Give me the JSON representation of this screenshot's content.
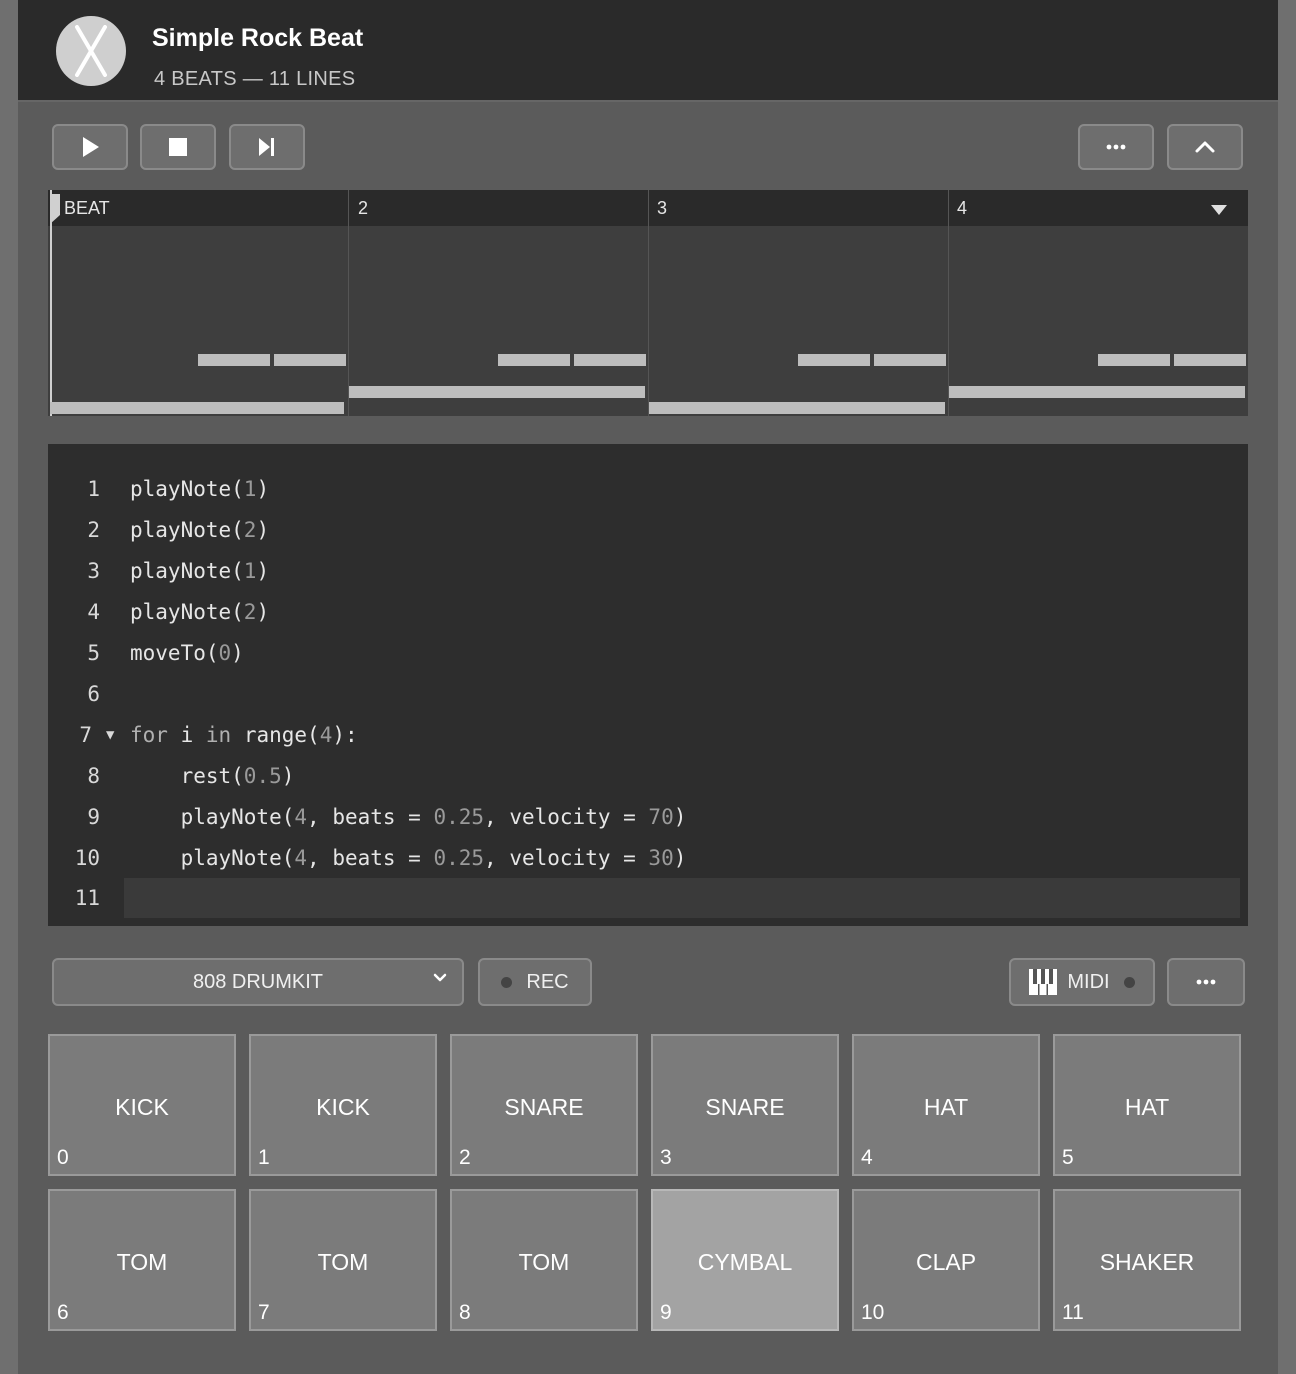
{
  "header": {
    "title": "Simple Rock Beat",
    "subtitle": "4 BEATS — 11 LINES"
  },
  "toolbar": {
    "play_icon": "play-icon",
    "stop_icon": "stop-icon",
    "step_icon": "step-forward-icon",
    "more_icon": "more-icon",
    "collapse_icon": "chevron-up-icon"
  },
  "timeline": {
    "beats": [
      "BEAT",
      "2",
      "3",
      "4"
    ]
  },
  "editor": {
    "lines": [
      {
        "num": "1",
        "code": "playNote(1)"
      },
      {
        "num": "2",
        "code": "playNote(2)"
      },
      {
        "num": "3",
        "code": "playNote(1)"
      },
      {
        "num": "4",
        "code": "playNote(2)"
      },
      {
        "num": "5",
        "code": "moveTo(0)"
      },
      {
        "num": "6",
        "code": ""
      },
      {
        "num": "7",
        "code": "for i in range(4):",
        "fold": "▼"
      },
      {
        "num": "8",
        "code": "    rest(0.5)"
      },
      {
        "num": "9",
        "code": "    playNote(4, beats = 0.25, velocity = 70)"
      },
      {
        "num": "10",
        "code": "    playNote(4, beats = 0.25, velocity = 30)"
      },
      {
        "num": "11",
        "code": ""
      }
    ]
  },
  "controls": {
    "instrument": "808 DRUMKIT",
    "rec_label": "REC",
    "midi_label": "MIDI"
  },
  "pads": [
    {
      "label": "KICK",
      "num": "0"
    },
    {
      "label": "KICK",
      "num": "1"
    },
    {
      "label": "SNARE",
      "num": "2"
    },
    {
      "label": "SNARE",
      "num": "3"
    },
    {
      "label": "HAT",
      "num": "4"
    },
    {
      "label": "HAT",
      "num": "5"
    },
    {
      "label": "TOM",
      "num": "6"
    },
    {
      "label": "TOM",
      "num": "7"
    },
    {
      "label": "TOM",
      "num": "8"
    },
    {
      "label": "CYMBAL",
      "num": "9",
      "active": true
    },
    {
      "label": "CLAP",
      "num": "10"
    },
    {
      "label": "SHAKER",
      "num": "11"
    }
  ]
}
